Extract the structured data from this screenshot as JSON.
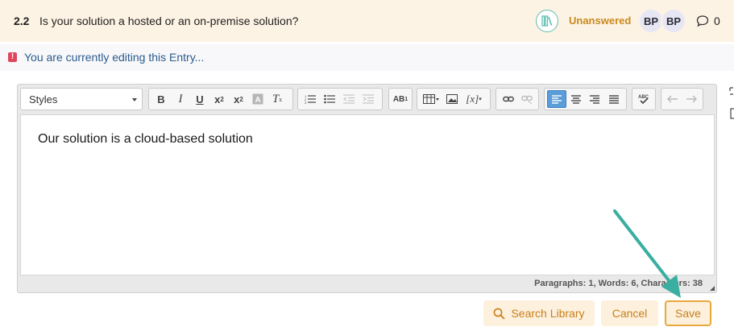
{
  "question": {
    "number": "2.2",
    "text": "Is your solution a hosted or an on-premise solution?",
    "status": "Unanswered",
    "status_color": "#c98a1e",
    "library_icon": "library-icon",
    "avatars": [
      "BP",
      "BP"
    ],
    "comment_count": "0"
  },
  "banner": {
    "text": "You are currently editing this Entry..."
  },
  "editor": {
    "styles_label": "Styles",
    "content": "Our solution is a cloud-based solution",
    "statusbar": "Paragraphs: 1, Words: 6, Characters: 38",
    "toolbar_icons": [
      "bold-icon",
      "italic-icon",
      "underline-icon",
      "subscript-icon",
      "superscript-icon",
      "copy-format-icon",
      "remove-format-icon",
      "numbered-list-icon",
      "bulleted-list-icon",
      "decrease-indent-icon",
      "increase-indent-icon",
      "spellcheck-language-icon",
      "table-icon",
      "image-icon",
      "placeholder-icon",
      "link-icon",
      "unlink-icon",
      "align-left-icon",
      "align-center-icon",
      "align-right-icon",
      "justify-icon",
      "spellcheck-icon",
      "undo-icon",
      "redo-icon"
    ]
  },
  "actions": {
    "search_library": "Search Library",
    "cancel": "Cancel",
    "save": "Save"
  },
  "colors": {
    "header_bg": "#fdf3e4",
    "accent": "#c7801a",
    "teal": "#3aaea0",
    "active_blue": "#5b9dd9"
  }
}
